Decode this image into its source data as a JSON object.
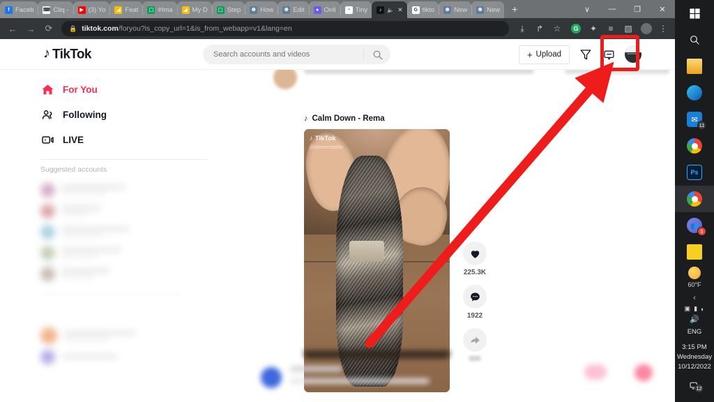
{
  "browser": {
    "tabs": [
      {
        "label": "Faceb",
        "favicon": "facebook-icon",
        "color": "#1877f2",
        "glyph": "f",
        "active": false
      },
      {
        "label": "Cliq -",
        "favicon": "cliq-icon",
        "color": "#ffffff",
        "glyph": "⌨",
        "active": false
      },
      {
        "label": "(3) Yo",
        "favicon": "youtube-icon",
        "color": "#ff0000",
        "glyph": "▶",
        "active": false
      },
      {
        "label": "Feat",
        "favicon": "google-slides-icon",
        "color": "#fbbc04",
        "glyph": "◢",
        "active": false
      },
      {
        "label": "#Ima",
        "favicon": "google-sheets-icon",
        "color": "#0f9d58",
        "glyph": "⬚",
        "active": false
      },
      {
        "label": "My D",
        "favicon": "google-drive-icon",
        "color": "#fbbc04",
        "glyph": "◢",
        "active": false
      },
      {
        "label": "Step",
        "favicon": "google-sheets-icon",
        "color": "#0f9d58",
        "glyph": "⬚",
        "active": false
      },
      {
        "label": "How",
        "favicon": "globe-icon",
        "color": "#5f7c99",
        "glyph": "☸",
        "active": false
      },
      {
        "label": "Edit",
        "favicon": "globe-icon",
        "color": "#5f7c99",
        "glyph": "☸",
        "active": false
      },
      {
        "label": "Onli",
        "favicon": "circle-icon",
        "color": "#6b5bf0",
        "glyph": "●",
        "active": false
      },
      {
        "label": "Tiny",
        "favicon": "panda-icon",
        "color": "#ffffff",
        "glyph": "◔",
        "active": false
      },
      {
        "label": "",
        "favicon": "tiktok-icon",
        "color": "#111111",
        "glyph": "♪",
        "active": true,
        "muted": true,
        "mute_icon": "speaker-icon",
        "close_icon": "close-icon"
      },
      {
        "label": "tikto",
        "favicon": "google-icon",
        "color": "#ffffff",
        "glyph": "G",
        "active": false
      },
      {
        "label": "New",
        "favicon": "globe-icon",
        "color": "#5f7c99",
        "glyph": "☸",
        "active": false
      },
      {
        "label": "New",
        "favicon": "globe-icon",
        "color": "#5f7c99",
        "glyph": "☸",
        "active": false
      }
    ],
    "new_tab_label": "+",
    "window_controls": {
      "dropdown": "∨",
      "minimize": "—",
      "maximize": "❐",
      "close": "✕"
    },
    "nav": {
      "back": "←",
      "forward": "→",
      "reload": "⟳"
    },
    "omnibox": {
      "lock_icon": "lock-icon",
      "domain": "tiktok.com",
      "path": "/foryou?is_copy_url=1&is_from_webapp=v1&lang=en"
    },
    "toolbar_icons": [
      {
        "name": "install-app-icon",
        "glyph": "⤓"
      },
      {
        "name": "share-icon",
        "glyph": "↱"
      },
      {
        "name": "bookmark-star-icon",
        "glyph": "☆"
      },
      {
        "name": "grammarly-icon",
        "glyph": "G"
      },
      {
        "name": "extension-puzzle-icon",
        "glyph": "✦"
      },
      {
        "name": "reading-list-icon",
        "glyph": "≡"
      },
      {
        "name": "side-panel-icon",
        "glyph": "▧"
      },
      {
        "name": "profile-avatar-icon",
        "glyph": ""
      },
      {
        "name": "chrome-menu-icon",
        "glyph": "⋮"
      }
    ]
  },
  "tiktok": {
    "logo_text": "TikTok",
    "logo_icon": "tiktok-note-icon",
    "search": {
      "placeholder": "Search accounts and videos",
      "value": "",
      "icon": "search-icon"
    },
    "upload_label": "Upload",
    "upload_plus": "+",
    "inbox_icon": "inbox-icon",
    "message_icon": "message-icon",
    "avatar_icon": "user-avatar",
    "sidebar": {
      "items": [
        {
          "label": "For You",
          "icon": "home-icon",
          "active": true
        },
        {
          "label": "Following",
          "icon": "people-icon",
          "active": false
        },
        {
          "label": "LIVE",
          "icon": "live-video-icon",
          "active": false
        }
      ],
      "suggested_label": "Suggested accounts"
    },
    "post": {
      "music_label": "Calm Down - Rema",
      "music_icon": "music-note-icon",
      "watermark": "TikTok",
      "watermark_user": "@iloveereptile",
      "like_count": "225.3K",
      "comment_count": "1922",
      "like_icon": "heart-icon",
      "comment_icon": "comment-icon",
      "share_icon": "share-arrow-icon"
    }
  },
  "annotation": {
    "highlight_color": "#ef1c1c",
    "arrow_color": "#ef1c1c",
    "arrow_from": "video-area",
    "arrow_to": "profile-avatar"
  },
  "taskbar": {
    "start_icon": "windows-start-icon",
    "search_icon": "search-icon",
    "items": [
      {
        "name": "file-explorer-icon",
        "glyph": "🗁",
        "badge": ""
      },
      {
        "name": "microsoft-edge-icon",
        "glyph": "◑",
        "badge": ""
      },
      {
        "name": "mail-icon",
        "glyph": "✉",
        "badge": "11"
      },
      {
        "name": "google-chrome-icon",
        "glyph": "●",
        "badge": ""
      },
      {
        "name": "photoshop-icon",
        "glyph": "Ps",
        "badge": ""
      },
      {
        "name": "chrome-active-icon",
        "glyph": "●",
        "badge": ""
      },
      {
        "name": "teams-icon",
        "glyph": "👥",
        "badge": "5"
      },
      {
        "name": "sticky-notes-icon",
        "glyph": "◢",
        "badge": ""
      }
    ],
    "weather_temp": "60°F",
    "weather_icon": "sun-cloud-icon",
    "chevron_icon": "chevron-up-icon",
    "sys_icons": [
      {
        "name": "screen-share-icon",
        "glyph": "▣"
      },
      {
        "name": "battery-icon",
        "glyph": "▬"
      },
      {
        "name": "wifi-icon",
        "glyph": "◠"
      }
    ],
    "volume_icon": "volume-icon",
    "language": "ENG",
    "time": "3:15 PM",
    "day": "Wednesday",
    "date": "10/12/2022",
    "notification_icon": "notification-icon",
    "notification_count": "12"
  }
}
